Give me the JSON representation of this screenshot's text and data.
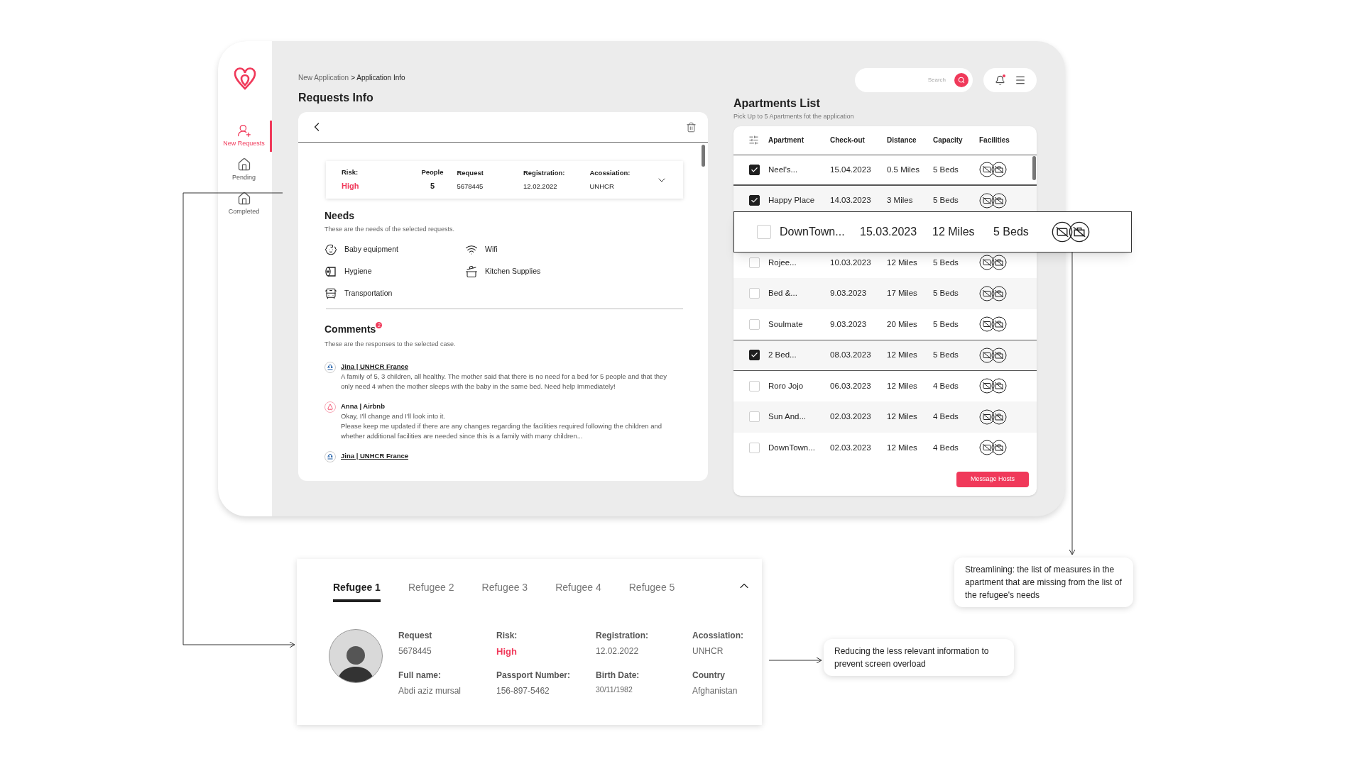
{
  "sidebar": {
    "items": [
      {
        "label": "New Requests",
        "kind": "new",
        "selected": true
      },
      {
        "label": "Pending",
        "kind": "pending",
        "selected": false
      },
      {
        "label": "Completed",
        "kind": "completed",
        "selected": false
      }
    ]
  },
  "breadcrumb": {
    "parent": "New Application",
    "current": "> Application Info"
  },
  "requests": {
    "title": "Requests Info",
    "summary": [
      {
        "label": "Risk:",
        "value": "High",
        "kind": "risk"
      },
      {
        "label": "People",
        "value": "5",
        "kind": "count"
      },
      {
        "label": "Request",
        "value": "5678445",
        "kind": "plain"
      },
      {
        "label": "Registration:",
        "value": "12.02.2022",
        "kind": "plain"
      },
      {
        "label": "Acossiation:",
        "value": "UNHCR",
        "kind": "plain"
      }
    ],
    "needs": {
      "title": "Needs",
      "subtitle": "These are the needs of the selected requests.",
      "items": [
        {
          "label": "Baby equipment",
          "kind": "baby"
        },
        {
          "label": "Wifi",
          "kind": "wifi"
        },
        {
          "label": "Hygiene",
          "kind": "hygiene"
        },
        {
          "label": "Kitchen Supplies",
          "kind": "kitchen"
        },
        {
          "label": "Transportation",
          "kind": "transport"
        }
      ]
    },
    "comments": {
      "title": "Comments",
      "count": "2",
      "subtitle": "These are the responses to the selected case.",
      "items": [
        {
          "author": "Jina | UNHCR France",
          "kind": "unhcr",
          "paragraphs": [
            "A family of 5, 3 children, all healthy. The mother said that there is no need for a bed for 5 people and that they only need 4 when the mother sleeps with the baby in the same bed. Need help Immediately!"
          ]
        },
        {
          "author": "Anna | Airbnb",
          "kind": "host",
          "paragraphs": [
            "Okay, I'll change and I'll look into it.",
            "Please keep me updated if there are any changes regarding the facilities required following the children and whether additional facilities are needed since this is a family with many children..."
          ]
        },
        {
          "author": "Jina | UNHCR France",
          "kind": "unhcr"
        }
      ]
    }
  },
  "search": {
    "placeholder": "Search"
  },
  "notifications": {
    "unread": true
  },
  "apartments": {
    "title": "Apartments List",
    "subtitle": "Pick Up to 5 Apartments fot the application",
    "columns": [
      "Apartment",
      "Check-out",
      "Distance",
      "Capacity",
      "Facilities"
    ],
    "rows": [
      {
        "kind": "row",
        "name": "Neel's...",
        "checkout": "15.04.2023",
        "distance": "0.5 Miles",
        "capacity": "5 Beds",
        "checked": true
      },
      {
        "kind": "row",
        "name": "Happy Place",
        "checkout": "14.03.2023",
        "distance": "3 Miles",
        "capacity": "5 Beds",
        "checked": true
      },
      {
        "kind": "row",
        "name": "Rojee...",
        "checkout": "10.03.2023",
        "distance": "12 Miles",
        "capacity": "5 Beds",
        "checked": false
      },
      {
        "kind": "row",
        "name": "Bed &...",
        "checkout": "9.03.2023",
        "distance": "17 Miles",
        "capacity": "5 Beds",
        "checked": false
      },
      {
        "kind": "row",
        "name": "Soulmate",
        "checkout": "9.03.2023",
        "distance": "20 Miles",
        "capacity": "5 Beds",
        "checked": false
      },
      {
        "kind": "row",
        "name": "2 Bed...",
        "checkout": "08.03.2023",
        "distance": "12 Miles",
        "capacity": "5 Beds",
        "checked": true
      },
      {
        "kind": "row",
        "name": "Roro Jojo",
        "checkout": "06.03.2023",
        "distance": "12 Miles",
        "capacity": "4 Beds",
        "checked": false
      },
      {
        "kind": "row",
        "name": "Sun And...",
        "checkout": "02.03.2023",
        "distance": "12 Miles",
        "capacity": "4 Beds",
        "checked": false
      },
      {
        "kind": "row",
        "name": "DownTown...",
        "checkout": "02.03.2023",
        "distance": "12 Miles",
        "capacity": "4 Beds",
        "checked": false
      }
    ],
    "zoomed_row": {
      "apartment": "DownTown...",
      "date": "15.03.2023",
      "miles": "12 Miles",
      "beds": "5 Beds",
      "checked": false
    },
    "button": "Message Hosts"
  },
  "refugee_card": {
    "tabs": [
      {
        "label": "Refugee 1",
        "selected": true
      },
      {
        "label": "Refugee 2",
        "selected": false
      },
      {
        "label": "Refugee 3",
        "selected": false
      },
      {
        "label": "Refugee 4",
        "selected": false
      },
      {
        "label": "Refugee 5",
        "selected": false
      }
    ],
    "fields": [
      {
        "label": "Request",
        "value": "5678445",
        "kind": "plain"
      },
      {
        "label": "Risk:",
        "value": "High",
        "kind": "risk"
      },
      {
        "label": "Registration:",
        "value": "12.02.2022",
        "kind": "plain"
      },
      {
        "label": "Acossiation:",
        "value": "UNHCR",
        "kind": "plain"
      },
      {
        "label": "Full name:",
        "value": "Abdi aziz mursal",
        "kind": "plain"
      },
      {
        "label": "Passport Number:",
        "value": "156-897-5462",
        "kind": "plain"
      },
      {
        "label": "Birth Date:",
        "value": "30/11/1982",
        "kind": "small"
      },
      {
        "label": "Country",
        "value": "Afghanistan",
        "kind": "plain"
      }
    ]
  },
  "callouts": [
    {
      "text": "Streamlining: the list of measures in the apartment that are missing from the list of the refugee's needs"
    },
    {
      "text": "Reducing the less relevant information to prevent screen overload"
    }
  ]
}
